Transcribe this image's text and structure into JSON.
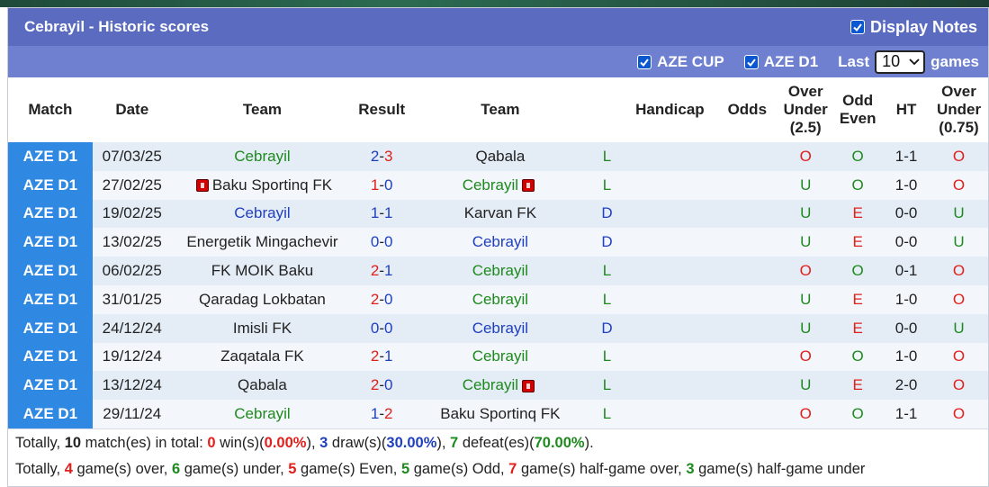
{
  "header": {
    "title": "Cebrayil - Historic scores",
    "display_notes_label": "Display Notes"
  },
  "filters": {
    "aze_cup_label": "AZE CUP",
    "aze_d1_label": "AZE D1",
    "last_label": "Last",
    "last_value": "10",
    "games_label": "games"
  },
  "columns": {
    "match": "Match",
    "date": "Date",
    "team": "Team",
    "result": "Result",
    "team2": "Team",
    "handicap": "Handicap",
    "odds": "Odds",
    "ou_line1": "Over",
    "ou_line2": "Under",
    "ou_line3": "(2.5)",
    "oe_line1": "Odd",
    "oe_line2": "Even",
    "ht": "HT",
    "ou2_line1": "Over",
    "ou2_line2": "Under",
    "ou2_line3": "(0.75)"
  },
  "rows": [
    {
      "league": "AZE D1",
      "date": "07/03/25",
      "home": "Cebrayil",
      "home_color": "green",
      "home_card": false,
      "score_h": "2",
      "sep": "-",
      "score_a": "3",
      "sh_color": "blue",
      "sa_color": "red",
      "away": "Qabala",
      "away_color": "dark",
      "away_card": false,
      "res": "L",
      "res_color": "green",
      "ou": "O",
      "ou_color": "red",
      "oe": "O",
      "oe_color": "green",
      "ht": "1-1",
      "ou2": "O",
      "ou2_color": "red"
    },
    {
      "league": "AZE D1",
      "date": "27/02/25",
      "home": "Baku Sportinq FK",
      "home_color": "dark",
      "home_card": true,
      "score_h": "1",
      "sep": "-",
      "score_a": "0",
      "sh_color": "red",
      "sa_color": "blue",
      "away": "Cebrayil",
      "away_color": "green",
      "away_card": true,
      "res": "L",
      "res_color": "green",
      "ou": "U",
      "ou_color": "green",
      "oe": "O",
      "oe_color": "green",
      "ht": "1-0",
      "ou2": "O",
      "ou2_color": "red"
    },
    {
      "league": "AZE D1",
      "date": "19/02/25",
      "home": "Cebrayil",
      "home_color": "blue",
      "home_card": false,
      "score_h": "1",
      "sep": "-",
      "score_a": "1",
      "sh_color": "blue",
      "sa_color": "blue",
      "away": "Karvan FK",
      "away_color": "dark",
      "away_card": false,
      "res": "D",
      "res_color": "blue",
      "ou": "U",
      "ou_color": "green",
      "oe": "E",
      "oe_color": "red",
      "ht": "0-0",
      "ou2": "U",
      "ou2_color": "green"
    },
    {
      "league": "AZE D1",
      "date": "13/02/25",
      "home": "Energetik Mingachevir",
      "home_color": "dark",
      "home_card": false,
      "score_h": "0",
      "sep": "-",
      "score_a": "0",
      "sh_color": "blue",
      "sa_color": "blue",
      "away": "Cebrayil",
      "away_color": "blue",
      "away_card": false,
      "res": "D",
      "res_color": "blue",
      "ou": "U",
      "ou_color": "green",
      "oe": "E",
      "oe_color": "red",
      "ht": "0-0",
      "ou2": "U",
      "ou2_color": "green"
    },
    {
      "league": "AZE D1",
      "date": "06/02/25",
      "home": "FK MOIK Baku",
      "home_color": "dark",
      "home_card": false,
      "score_h": "2",
      "sep": "-",
      "score_a": "1",
      "sh_color": "red",
      "sa_color": "blue",
      "away": "Cebrayil",
      "away_color": "green",
      "away_card": false,
      "res": "L",
      "res_color": "green",
      "ou": "O",
      "ou_color": "red",
      "oe": "O",
      "oe_color": "green",
      "ht": "0-1",
      "ou2": "O",
      "ou2_color": "red"
    },
    {
      "league": "AZE D1",
      "date": "31/01/25",
      "home": "Qaradag Lokbatan",
      "home_color": "dark",
      "home_card": false,
      "score_h": "2",
      "sep": "-",
      "score_a": "0",
      "sh_color": "red",
      "sa_color": "blue",
      "away": "Cebrayil",
      "away_color": "green",
      "away_card": false,
      "res": "L",
      "res_color": "green",
      "ou": "U",
      "ou_color": "green",
      "oe": "E",
      "oe_color": "red",
      "ht": "1-0",
      "ou2": "O",
      "ou2_color": "red"
    },
    {
      "league": "AZE D1",
      "date": "24/12/24",
      "home": "Imisli FK",
      "home_color": "dark",
      "home_card": false,
      "score_h": "0",
      "sep": "-",
      "score_a": "0",
      "sh_color": "blue",
      "sa_color": "blue",
      "away": "Cebrayil",
      "away_color": "blue",
      "away_card": false,
      "res": "D",
      "res_color": "blue",
      "ou": "U",
      "ou_color": "green",
      "oe": "E",
      "oe_color": "red",
      "ht": "0-0",
      "ou2": "U",
      "ou2_color": "green"
    },
    {
      "league": "AZE D1",
      "date": "19/12/24",
      "home": "Zaqatala FK",
      "home_color": "dark",
      "home_card": false,
      "score_h": "2",
      "sep": "-",
      "score_a": "1",
      "sh_color": "red",
      "sa_color": "blue",
      "away": "Cebrayil",
      "away_color": "green",
      "away_card": false,
      "res": "L",
      "res_color": "green",
      "ou": "O",
      "ou_color": "red",
      "oe": "O",
      "oe_color": "green",
      "ht": "1-0",
      "ou2": "O",
      "ou2_color": "red"
    },
    {
      "league": "AZE D1",
      "date": "13/12/24",
      "home": "Qabala",
      "home_color": "dark",
      "home_card": false,
      "score_h": "2",
      "sep": "-",
      "score_a": "0",
      "sh_color": "red",
      "sa_color": "blue",
      "away": "Cebrayil",
      "away_color": "green",
      "away_card": true,
      "res": "L",
      "res_color": "green",
      "ou": "U",
      "ou_color": "green",
      "oe": "E",
      "oe_color": "red",
      "ht": "2-0",
      "ou2": "O",
      "ou2_color": "red"
    },
    {
      "league": "AZE D1",
      "date": "29/11/24",
      "home": "Cebrayil",
      "home_color": "green",
      "home_card": false,
      "score_h": "1",
      "sep": "-",
      "score_a": "2",
      "sh_color": "blue",
      "sa_color": "red",
      "away": "Baku Sportinq FK",
      "away_color": "dark",
      "away_card": false,
      "res": "L",
      "res_color": "green",
      "ou": "O",
      "ou_color": "red",
      "oe": "O",
      "oe_color": "green",
      "ht": "1-1",
      "ou2": "O",
      "ou2_color": "red"
    }
  ],
  "summary1": [
    {
      "t": "Totally, ",
      "c": "dark",
      "b": false
    },
    {
      "t": "10",
      "c": "dark",
      "b": true
    },
    {
      "t": " match(es) in total: ",
      "c": "dark",
      "b": false
    },
    {
      "t": "0",
      "c": "red",
      "b": true
    },
    {
      "t": " win(s)(",
      "c": "dark",
      "b": false
    },
    {
      "t": "0.00%",
      "c": "red",
      "b": true
    },
    {
      "t": "), ",
      "c": "dark",
      "b": false
    },
    {
      "t": "3",
      "c": "blue",
      "b": true
    },
    {
      "t": " draw(s)(",
      "c": "dark",
      "b": false
    },
    {
      "t": "30.00%",
      "c": "blue",
      "b": true
    },
    {
      "t": "), ",
      "c": "dark",
      "b": false
    },
    {
      "t": "7",
      "c": "green",
      "b": true
    },
    {
      "t": " defeat(es)(",
      "c": "dark",
      "b": false
    },
    {
      "t": "70.00%",
      "c": "green",
      "b": true
    },
    {
      "t": ").",
      "c": "dark",
      "b": false
    }
  ],
  "summary2": [
    {
      "t": "Totally, ",
      "c": "dark",
      "b": false
    },
    {
      "t": "4",
      "c": "red",
      "b": true
    },
    {
      "t": " game(s) over, ",
      "c": "dark",
      "b": false
    },
    {
      "t": "6",
      "c": "green",
      "b": true
    },
    {
      "t": " game(s) under, ",
      "c": "dark",
      "b": false
    },
    {
      "t": "5",
      "c": "red",
      "b": true
    },
    {
      "t": " game(s) Even, ",
      "c": "dark",
      "b": false
    },
    {
      "t": "5",
      "c": "green",
      "b": true
    },
    {
      "t": " game(s) Odd, ",
      "c": "dark",
      "b": false
    },
    {
      "t": "7",
      "c": "red",
      "b": true
    },
    {
      "t": " game(s) half-game over, ",
      "c": "dark",
      "b": false
    },
    {
      "t": "3",
      "c": "green",
      "b": true
    },
    {
      "t": " game(s) half-game under",
      "c": "dark",
      "b": false
    }
  ],
  "colors": {
    "title_bg": "#5b6cc0",
    "filter_bg": "#6f80d0",
    "league_bg": "#2f88e2",
    "green": "#1d8a1d",
    "blue": "#1f3fbf",
    "red": "#e0201b"
  }
}
